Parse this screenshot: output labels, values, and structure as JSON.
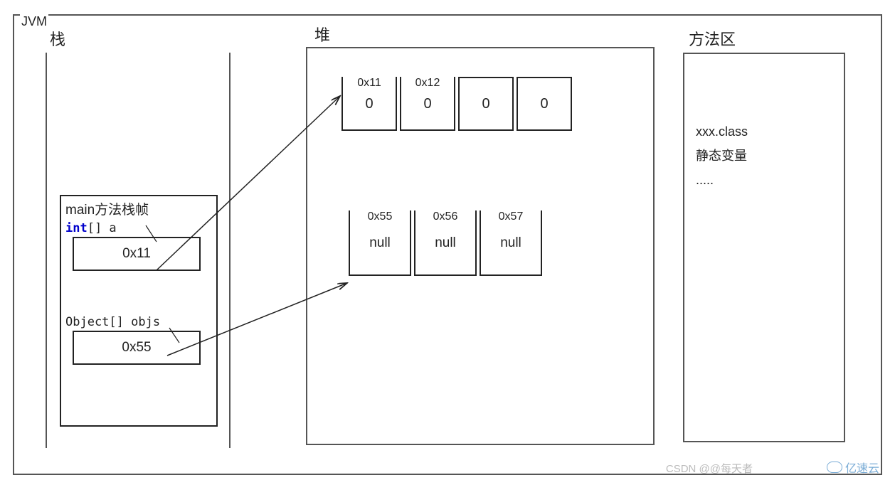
{
  "jvm": {
    "title": "JVM"
  },
  "stack": {
    "title": "栈",
    "frame_title": "main方法栈帧",
    "var_a": {
      "type_kw": "int",
      "type_rest": "[] a",
      "value": "0x11"
    },
    "var_objs": {
      "decl": "Object[] objs",
      "value": "0x55"
    }
  },
  "heap": {
    "title": "堆",
    "int_array": {
      "cells": [
        {
          "addr": "0x11",
          "value": "0"
        },
        {
          "addr": "0x12",
          "value": "0"
        },
        {
          "addr": "",
          "value": "0"
        },
        {
          "addr": "",
          "value": "0"
        }
      ]
    },
    "obj_array": {
      "cells": [
        {
          "addr": "0x55",
          "value": "null"
        },
        {
          "addr": "0x56",
          "value": "null"
        },
        {
          "addr": "0x57",
          "value": "null"
        }
      ]
    }
  },
  "method_area": {
    "title": "方法区",
    "lines": [
      "xxx.class",
      "静态变量",
      "....."
    ]
  },
  "watermarks": {
    "csdn": "CSDN @@每天者",
    "ysy": "亿速云"
  }
}
